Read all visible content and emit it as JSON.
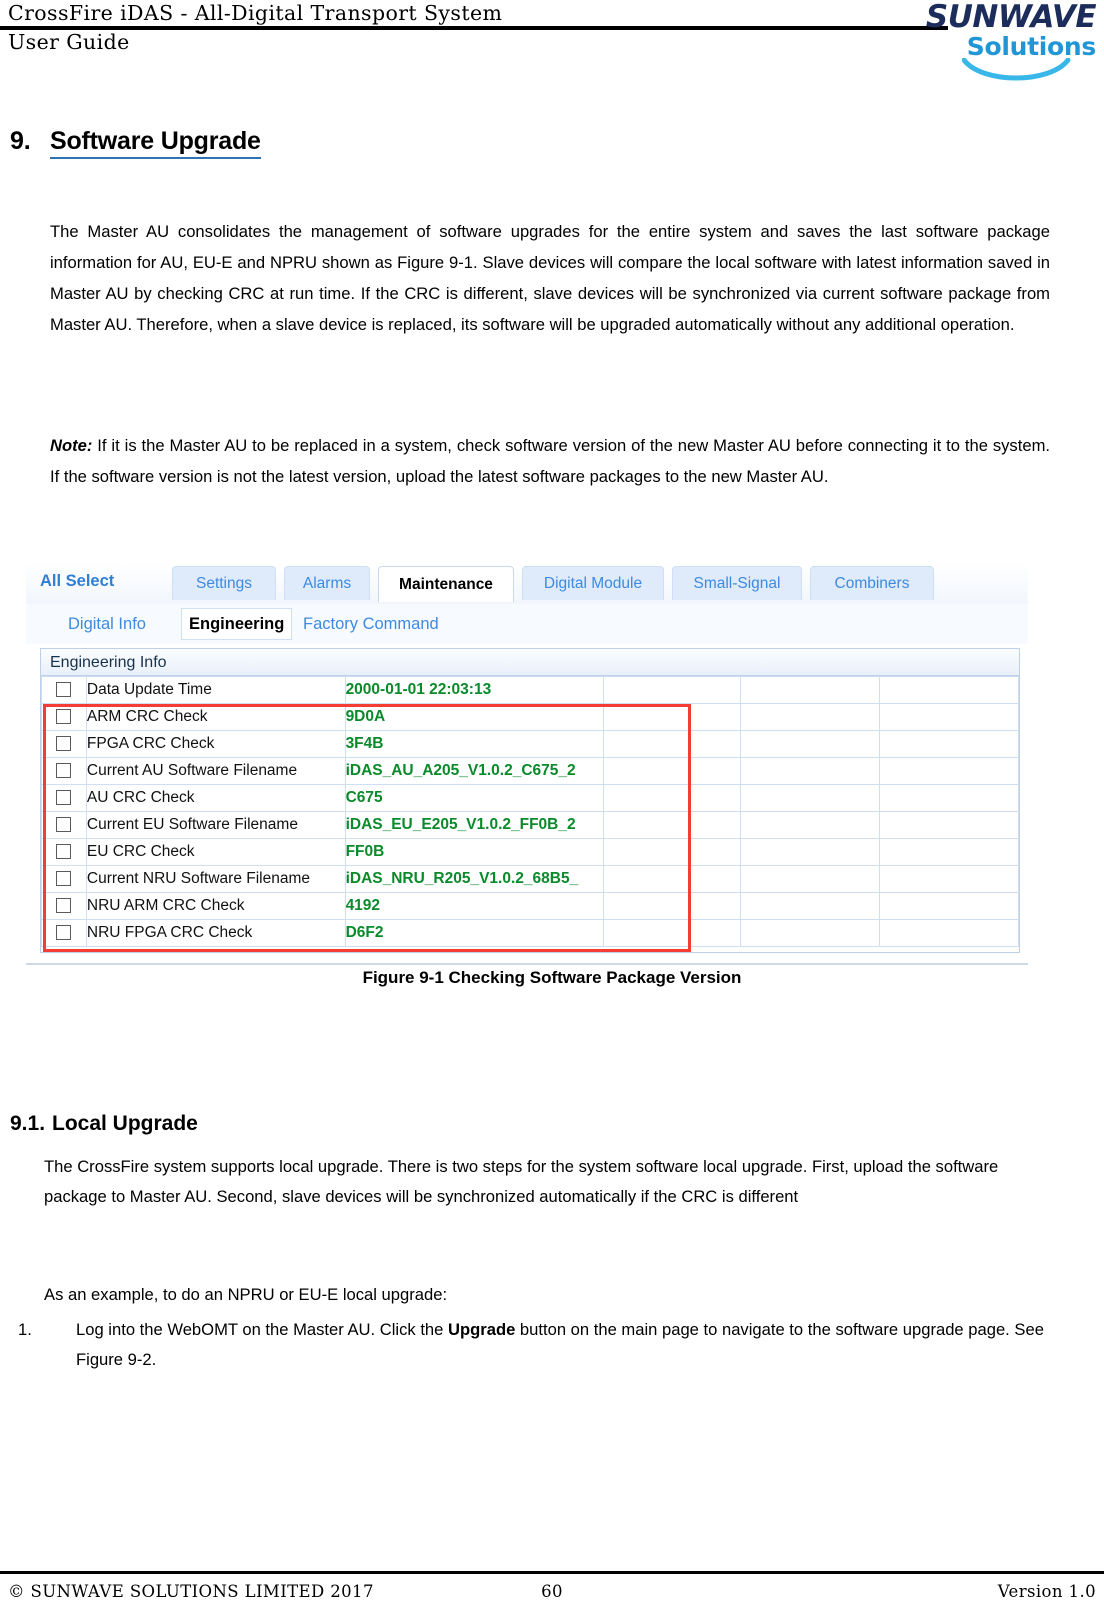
{
  "header": {
    "title": "CrossFire iDAS - All-Digital Transport System",
    "subtitle": "User Guide",
    "logo_primary": "SUNWAVE",
    "logo_secondary": "Solutions"
  },
  "section": {
    "number": "9.",
    "title": "Software Upgrade",
    "paragraph_1": "The Master AU consolidates the management of software upgrades for the entire system and saves the last software package information for AU, EU-E and NPRU shown as Figure 9-1. Slave devices will compare the local software with latest information saved in Master AU by checking CRC at run time. If the CRC is different, slave devices will be synchronized via current software package from Master AU. Therefore, when a slave device is replaced, its software will be upgraded automatically without any additional operation.",
    "note_label": "Note:",
    "note_text": " If it is the Master AU to be replaced in a system, check software version of the new Master AU before connecting it to the system. If the software version is not the latest version, upload the latest software packages to the new Master AU."
  },
  "figure": {
    "caption": "Figure 9-1 Checking Software Package Version",
    "all_select_label": "All Select",
    "tabs": [
      {
        "label": "Settings",
        "active": false
      },
      {
        "label": "Alarms",
        "active": false
      },
      {
        "label": "Maintenance",
        "active": true
      },
      {
        "label": "Digital Module",
        "active": false
      },
      {
        "label": "Small-Signal",
        "active": false
      },
      {
        "label": "Combiners",
        "active": false
      }
    ],
    "subtabs": [
      {
        "label": "Digital Info",
        "active": false
      },
      {
        "label": "Engineering",
        "active": true
      },
      {
        "label": "Factory Command",
        "active": false
      }
    ],
    "grid_title": "Engineering Info",
    "rows": [
      {
        "label": "Data Update Time",
        "value": "2000-01-01 22:03:13"
      },
      {
        "label": "ARM CRC Check",
        "value": "9D0A"
      },
      {
        "label": "FPGA CRC Check",
        "value": "3F4B"
      },
      {
        "label": "Current AU Software Filename",
        "value": "iDAS_AU_A205_V1.0.2_C675_2"
      },
      {
        "label": "AU CRC Check",
        "value": "C675"
      },
      {
        "label": "Current EU Software Filename",
        "value": "iDAS_EU_E205_V1.0.2_FF0B_2"
      },
      {
        "label": "EU CRC Check",
        "value": "FF0B"
      },
      {
        "label": "Current NRU Software Filename",
        "value": "iDAS_NRU_R205_V1.0.2_68B5_"
      },
      {
        "label": "NRU ARM CRC Check",
        "value": "4192"
      },
      {
        "label": "NRU FPGA CRC Check",
        "value": "D6F2"
      }
    ],
    "highlight_color": "#f63d33",
    "value_color": "#0a8a2a",
    "tab_text_color": "#3d8ae0"
  },
  "subsection": {
    "number": "9.1.",
    "title": "Local Upgrade",
    "paragraph_1": "The CrossFire system supports local upgrade. There is two steps for the system software local upgrade. First, upload the software package to Master AU. Second, slave devices will be synchronized automatically if the CRC is different",
    "paragraph_2": "As an example, to do an NPRU or EU-E local upgrade:",
    "list": [
      {
        "number": "1.",
        "text_before": "Log into the WebOMT on the Master AU. Click the ",
        "bold": "Upgrade",
        "text_after": " button on the main page to navigate to the software upgrade page. See Figure 9-2."
      }
    ]
  },
  "footer": {
    "copyright": "© SUNWAVE SOLUTIONS LIMITED 2017",
    "page_number": "60",
    "version": "Version 1.0"
  }
}
